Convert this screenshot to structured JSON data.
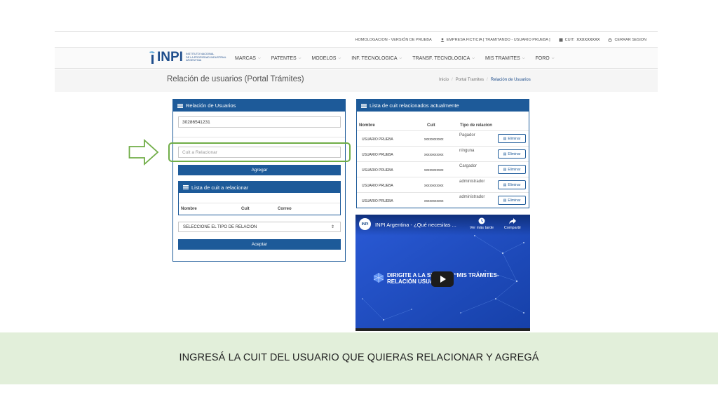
{
  "utility": {
    "env": "HOMOLOGACION - VERSIÓN DE PRUEBA",
    "company": "EMPRESA FICTICIA [ TRAMITANDO - USUARIO PRUEBA ]",
    "cuit_label": "CUIT:",
    "cuit_value": "XXXXXXXXX",
    "logout": "CERRAR SESION"
  },
  "logo": {
    "word": "INPI",
    "line1": "INSTITUTO NACIONAL",
    "line2": "DE LA PROPIEDAD INDUSTRIAL",
    "line3": "ARGENTINA"
  },
  "menu": [
    "MARCAS",
    "PATENTES",
    "MODELOS",
    "INF. TECNOLOGICA",
    "TRANSF. TECNOLOGICA",
    "MIS TRAMITES",
    "FORO"
  ],
  "page": {
    "title": "Relación de usuarios (Portal Trámites)",
    "breadcrumb": [
      "Inicio",
      "Portal Tramites",
      "Relación de Usuarios"
    ]
  },
  "relacion_panel": {
    "title": "Relación de Usuarios",
    "cuit_value": "30286541231",
    "cuit_rel_placeholder": "Cuit a Relacionar",
    "add_button": "Agregar",
    "sub_title": "Lista de cuit a relacionar",
    "sub_columns": [
      "Nombre",
      "Cuit",
      "Correo"
    ],
    "select_value": "SELECCIONE EL TIPO DE RELACION",
    "accept_button": "Aceptar"
  },
  "current_panel": {
    "title": "Lista de cuit relacionados actualmente",
    "columns": [
      "Nombre",
      "Cuit",
      "Tipo de relacion"
    ],
    "delete_label": "Eliminar",
    "rows": [
      {
        "nombre": "USUARIO PRUEBA",
        "cuit": "xxxxxxxxxxx",
        "tipo": "Pagador"
      },
      {
        "nombre": "USUARIO PRUEBA",
        "cuit": "xxxxxxxxxxx",
        "tipo": "ninguna"
      },
      {
        "nombre": "USUARIO PRUEBA",
        "cuit": "xxxxxxxxxxx",
        "tipo": "Cargador"
      },
      {
        "nombre": "USUARIO PRUEBA",
        "cuit": "xxxxxxxxxxx",
        "tipo": "administrador"
      },
      {
        "nombre": "USUARIO PRUEBA",
        "cuit": "xxxxxxxxxxx",
        "tipo": "administrador"
      }
    ]
  },
  "video": {
    "logo": "INPI",
    "title": "INPI Argentina - ¿Qué necesitas ...",
    "watch_later": "Ver más tarde",
    "share": "Compartir",
    "caption_line1": "DIRIGITE A LA SECCIÓN “MIS TRÁMITES-",
    "caption_line2": "RELACIÓN USUARIOS”"
  },
  "caption": "INGRESÁ LA CUIT DEL USUARIO QUE QUIERAS RELACIONAR Y AGREGÁ",
  "colors": {
    "primary": "#1d5a99",
    "highlight": "#70ad47",
    "band": "#e2efda",
    "video_bg": "#1e4fc0"
  }
}
